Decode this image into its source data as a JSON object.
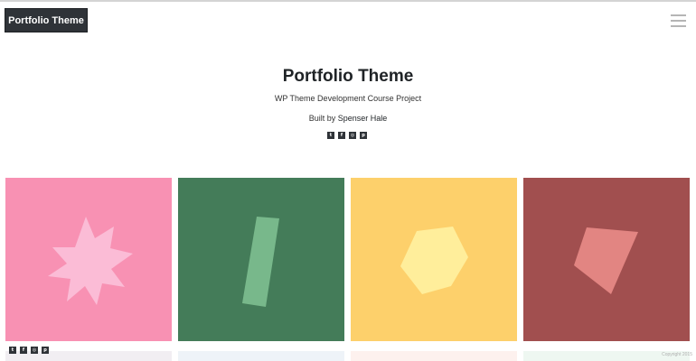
{
  "header": {
    "brand_label": "Portfolio Theme",
    "menu_icon": "hamburger-menu-icon"
  },
  "hero": {
    "title": "Portfolio Theme",
    "subtitle": "WP Theme Development Course Project",
    "built_by_prefix": "Built by",
    "author": "Spenser Hale"
  },
  "social": [
    {
      "icon": "twitter-icon",
      "glyph": "t"
    },
    {
      "icon": "facebook-icon",
      "glyph": "f"
    },
    {
      "icon": "instagram-icon",
      "glyph": "◎"
    },
    {
      "icon": "pinterest-icon",
      "glyph": "p"
    }
  ],
  "portfolio": [
    {
      "item": "star-shape",
      "bg": "#f891b3",
      "shape_color": "#fbbcd6"
    },
    {
      "item": "bar-shape",
      "bg": "#447c59",
      "shape_color": "#78b88b"
    },
    {
      "item": "hexagon-shape",
      "bg": "#fdd06b",
      "shape_color": "#ffee9b"
    },
    {
      "item": "quad-shape",
      "bg": "#a14f4f",
      "shape_color": "#e28582"
    }
  ],
  "footer": {
    "copyright": "Copyright 2015"
  },
  "colors": {
    "brand_bg": "#2f3338",
    "text_dark": "#1f2326"
  }
}
